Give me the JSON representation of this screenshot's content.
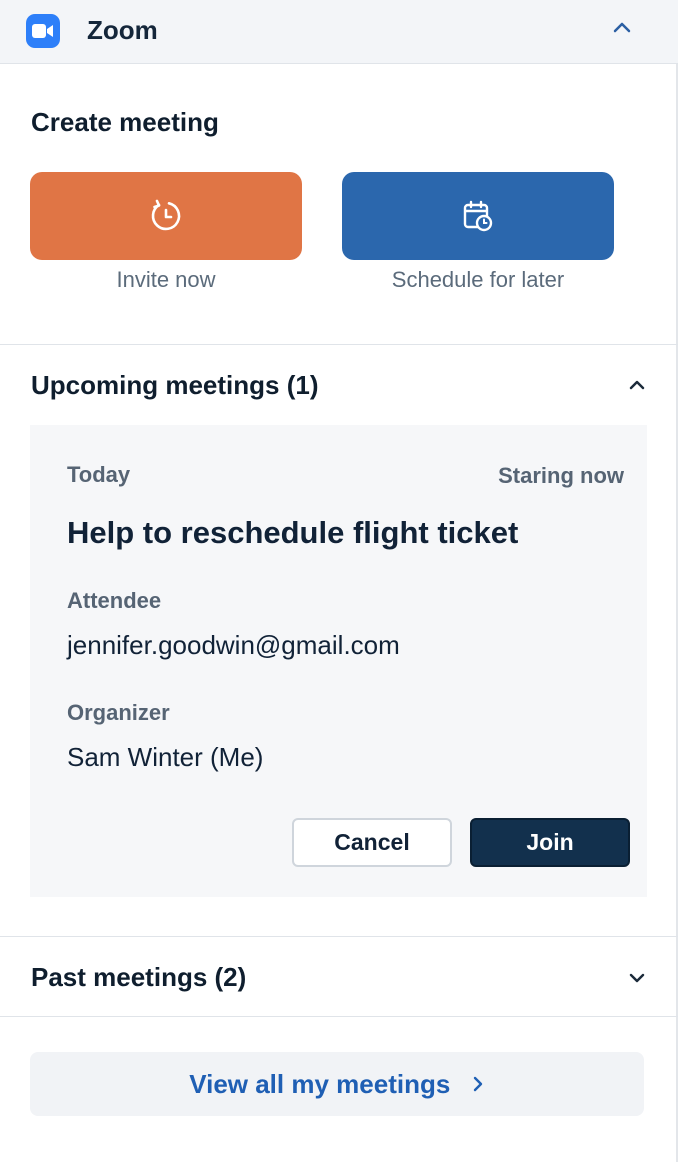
{
  "header": {
    "app_name": "Zoom",
    "logo_icon": "zoom-camera-icon",
    "collapse_icon": "chevron-up-icon"
  },
  "create_meeting": {
    "title": "Create meeting",
    "invite_now": {
      "label": "Invite now",
      "icon": "instant-clock-icon",
      "color": "#e07545"
    },
    "schedule_later": {
      "label": "Schedule for later",
      "icon": "calendar-clock-icon",
      "color": "#2b67ad"
    }
  },
  "upcoming": {
    "title": "Upcoming meetings (1)",
    "toggle_icon": "chevron-up-icon",
    "meeting": {
      "day": "Today",
      "status": "Staring now",
      "title": "Help to reschedule flight ticket",
      "attendee_label": "Attendee",
      "attendee_value": "jennifer.goodwin@gmail.com",
      "organizer_label": "Organizer",
      "organizer_value": "Sam Winter (Me)",
      "cancel_label": "Cancel",
      "join_label": "Join"
    }
  },
  "past": {
    "title": "Past meetings (2)",
    "toggle_icon": "chevron-down-icon"
  },
  "footer": {
    "view_all_label": "View all my meetings",
    "view_all_icon": "chevron-right-icon"
  },
  "colors": {
    "accent_blue": "#1f5fb4",
    "join_dark": "#12304d",
    "zoom_blue": "#2d7ff9"
  }
}
